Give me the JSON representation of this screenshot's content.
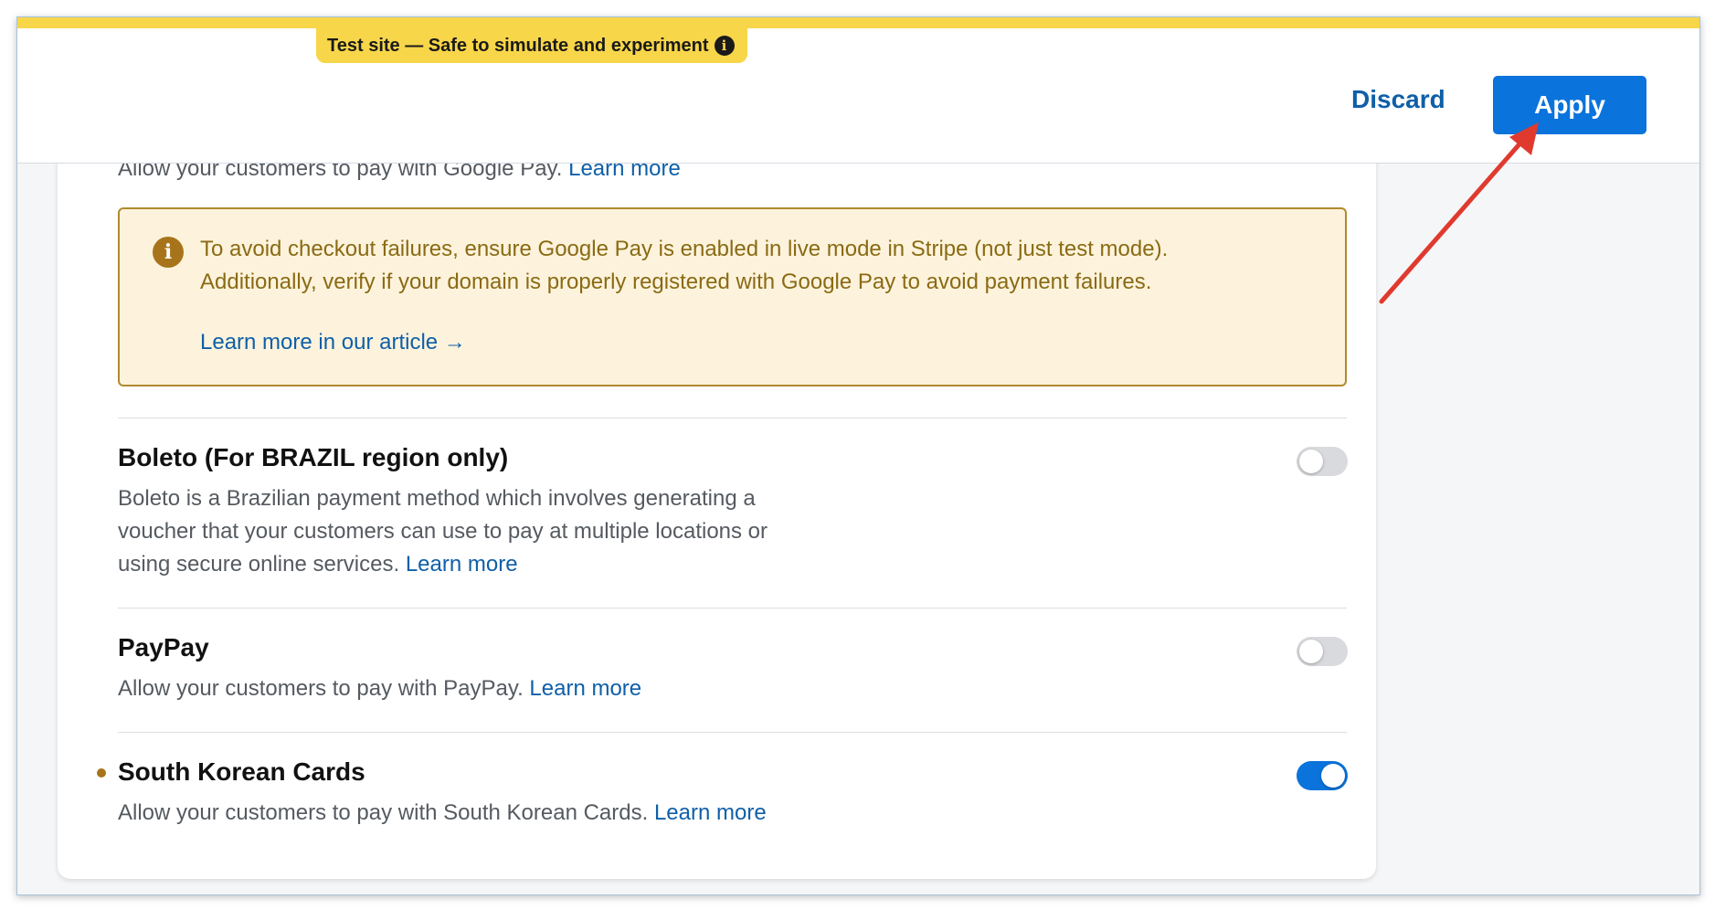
{
  "banner": {
    "text": "Test site — Safe to simulate and experiment",
    "info_icon": "i"
  },
  "header": {
    "discard_label": "Discard",
    "apply_label": "Apply"
  },
  "google_pay": {
    "description": "Allow your customers to pay with Google Pay.",
    "learn_more": "Learn more",
    "warning": {
      "icon": "i",
      "line1": "To avoid checkout failures, ensure Google Pay is enabled in live mode in Stripe (not just test mode).",
      "line2": "Additionally, verify if your domain is properly registered with Google Pay to avoid payment failures.",
      "link": "Learn more in our article →"
    }
  },
  "methods": [
    {
      "title": "Boleto (For BRAZIL region only)",
      "description_lines": [
        "Boleto is a Brazilian payment method which involves generating a",
        "voucher that your customers can use to pay at multiple locations or",
        "using secure online services."
      ],
      "learn_more": "Learn more",
      "enabled": false
    },
    {
      "title": "PayPay",
      "description": "Allow your customers to pay with PayPay.",
      "learn_more": "Learn more",
      "enabled": false
    },
    {
      "title": "South Korean Cards",
      "description": "Allow your customers to pay with South Korean Cards.",
      "learn_more": "Learn more",
      "enabled": true,
      "changed": true
    }
  ],
  "colors": {
    "accent": "#0a73dc",
    "test_banner": "#f8d649",
    "warning_bg": "#fdf3dc",
    "annotation_arrow": "#e03a2f"
  }
}
